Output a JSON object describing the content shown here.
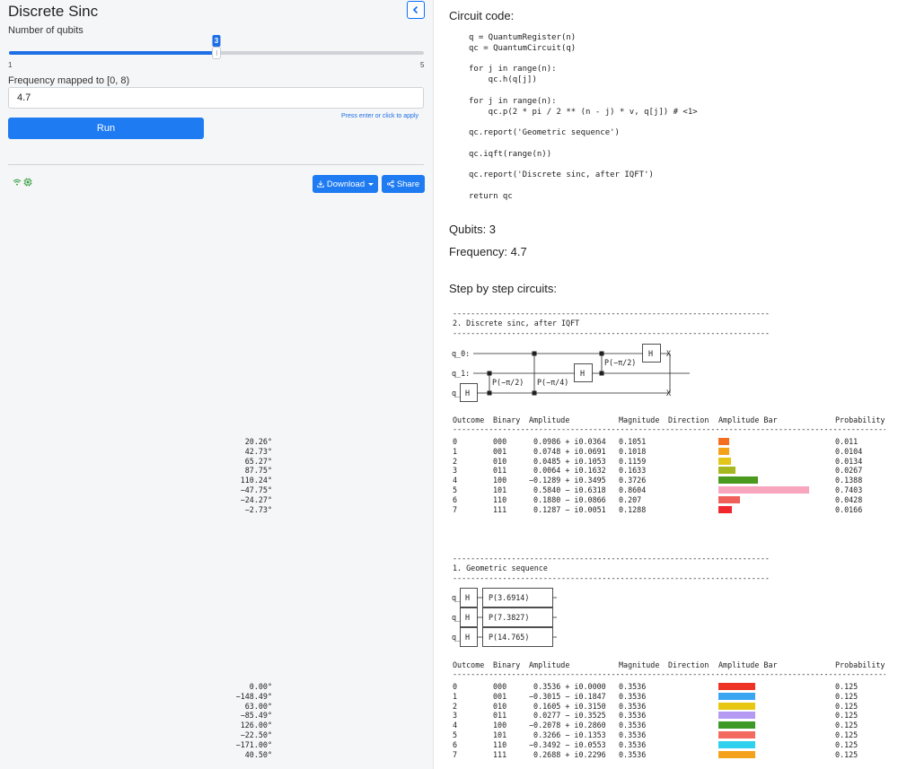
{
  "sidebar": {
    "title": "Discrete Sinc",
    "qubits_label": "Number of qubits",
    "slider": {
      "min": 1,
      "max": 5,
      "value": 3,
      "min_label": "1",
      "max_label": "5",
      "value_label": "3"
    },
    "frequency_label": "Frequency mapped to [0, 8)",
    "frequency_value": "4.7",
    "hint": "Press enter or click to apply",
    "run_label": "Run",
    "download_label": "Download",
    "share_label": "Share",
    "accent_color": "#1e7bf2"
  },
  "main": {
    "code_title": "Circuit code:",
    "code_lines": [
      "q = QuantumRegister(n)",
      "qc = QuantumCircuit(q)",
      "",
      "for j in range(n):",
      "    qc.h(q[j])",
      "",
      "for j in range(n):",
      "    qc.p(2 * pi / 2 ** (n - j) * v, q[j]) # <1>",
      "",
      "qc.report('Geometric sequence')",
      "",
      "qc.iqft(range(n))",
      "",
      "qc.report('Discrete sinc, after IQFT')",
      "",
      "return qc"
    ],
    "qubits_text": "Qubits: 3",
    "frequency_text": "Frequency: 4.7",
    "steps_title": "Step by step circuits:",
    "rule": "----------------------------------------------------------------------",
    "table_rule": "-----------------------------------------------------------------------------------------------------------------------------------------",
    "columns": [
      "Outcome",
      "Binary",
      "Amplitude",
      "Magnitude",
      "Direction",
      "Amplitude Bar",
      "Probability"
    ],
    "steps": [
      {
        "title": "2. Discrete sinc, after IQFT",
        "wires": [
          "q_0:",
          "q_1:",
          "q_2:"
        ],
        "gates": {
          "h": "H",
          "p1": "P(−π/2)",
          "p2": "P(−π/4)",
          "p3": "P(−π/2)",
          "swap": "X"
        },
        "rows": [
          {
            "outcome": "0",
            "binary": "000",
            "amplitude": " 0.0986 + i0.0364",
            "magnitude": "0.1051",
            "direction": "20.26°",
            "bar": 0.1051,
            "color": "#f46d21",
            "probability": "0.011"
          },
          {
            "outcome": "1",
            "binary": "001",
            "amplitude": " 0.0748 + i0.0691",
            "magnitude": "0.1018",
            "direction": "42.73°",
            "bar": 0.1018,
            "color": "#f5a21b",
            "probability": "0.0104"
          },
          {
            "outcome": "2",
            "binary": "010",
            "amplitude": " 0.0485 + i0.1053",
            "magnitude": "0.1159",
            "direction": "65.27°",
            "bar": 0.1159,
            "color": "#e4c51a",
            "probability": "0.0134"
          },
          {
            "outcome": "3",
            "binary": "011",
            "amplitude": " 0.0064 + i0.1632",
            "magnitude": "0.1633",
            "direction": "87.75°",
            "bar": 0.1633,
            "color": "#a5b81f",
            "probability": "0.0267"
          },
          {
            "outcome": "4",
            "binary": "100",
            "amplitude": "−0.1289 + i0.3495",
            "magnitude": "0.3726",
            "direction": "110.24°",
            "bar": 0.3726,
            "color": "#4a9a1f",
            "probability": "0.1388"
          },
          {
            "outcome": "5",
            "binary": "101",
            "amplitude": " 0.5840 − i0.6318",
            "magnitude": "0.8604",
            "direction": "−47.75°",
            "bar": 0.8604,
            "color": "#f8a6bd",
            "probability": "0.7403"
          },
          {
            "outcome": "6",
            "binary": "110",
            "amplitude": " 0.1880 − i0.0866",
            "magnitude": "0.207",
            "direction": "−24.27°",
            "bar": 0.207,
            "color": "#f0605b",
            "probability": "0.0428"
          },
          {
            "outcome": "7",
            "binary": "111",
            "amplitude": " 0.1287 − i0.0051",
            "magnitude": "0.1288",
            "direction": "−2.73°",
            "bar": 0.1288,
            "color": "#f0282d",
            "probability": "0.0166"
          }
        ]
      },
      {
        "title": "1. Geometric sequence",
        "wires": [
          "q_0:",
          "q_1:",
          "q_2:"
        ],
        "gates": {
          "h": "H",
          "p0": "P(3.6914)",
          "p1": "P(7.3827)",
          "p2": "P(14.765)"
        },
        "rows": [
          {
            "outcome": "0",
            "binary": "000",
            "amplitude": " 0.3536 + i0.0000",
            "magnitude": "0.3536",
            "direction": "0.00°",
            "bar": 0.3536,
            "color": "#ee3324",
            "probability": "0.125"
          },
          {
            "outcome": "1",
            "binary": "001",
            "amplitude": "−0.3015 − i0.1847",
            "magnitude": "0.3536",
            "direction": "−148.49°",
            "bar": 0.3536,
            "color": "#3aa6f2",
            "probability": "0.125"
          },
          {
            "outcome": "2",
            "binary": "010",
            "amplitude": " 0.1605 + i0.3150",
            "magnitude": "0.3536",
            "direction": "63.00°",
            "bar": 0.3536,
            "color": "#e8c712",
            "probability": "0.125"
          },
          {
            "outcome": "3",
            "binary": "011",
            "amplitude": " 0.0277 − i0.3525",
            "magnitude": "0.3536",
            "direction": "−85.49°",
            "bar": 0.3536,
            "color": "#b49af2",
            "probability": "0.125"
          },
          {
            "outcome": "4",
            "binary": "100",
            "amplitude": "−0.2078 + i0.2860",
            "magnitude": "0.3536",
            "direction": "126.00°",
            "bar": 0.3536,
            "color": "#3d9a26",
            "probability": "0.125"
          },
          {
            "outcome": "5",
            "binary": "101",
            "amplitude": " 0.3266 − i0.1353",
            "magnitude": "0.3536",
            "direction": "−22.50°",
            "bar": 0.3536,
            "color": "#f36a5e",
            "probability": "0.125"
          },
          {
            "outcome": "6",
            "binary": "110",
            "amplitude": "−0.3492 − i0.0553",
            "magnitude": "0.3536",
            "direction": "−171.00°",
            "bar": 0.3536,
            "color": "#2fd1ef",
            "probability": "0.125"
          },
          {
            "outcome": "7",
            "binary": "111",
            "amplitude": " 0.2688 + i0.2296",
            "magnitude": "0.3536",
            "direction": "40.50°",
            "bar": 0.3536,
            "color": "#f4a21c",
            "probability": "0.125"
          }
        ]
      }
    ]
  }
}
